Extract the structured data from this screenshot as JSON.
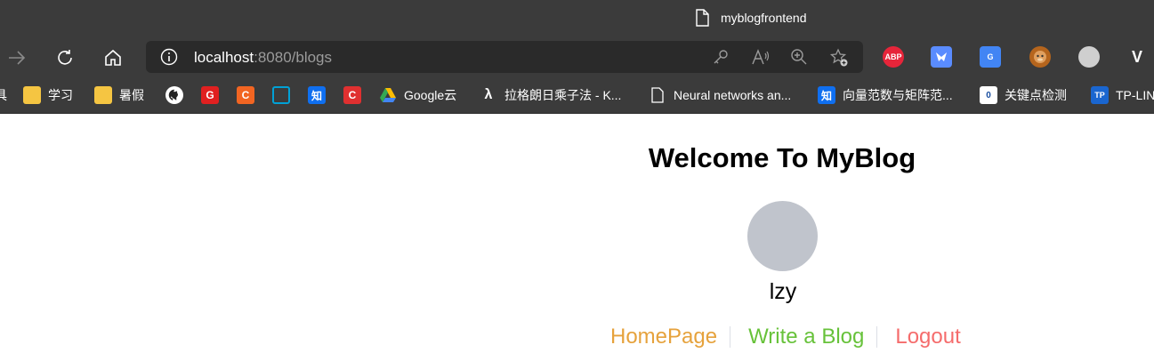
{
  "window": {
    "title": "myblogfrontend"
  },
  "address_bar": {
    "host": "localhost",
    "path": ":8080/blogs"
  },
  "bookmarks": [
    {
      "label": "具",
      "icon": "folder-icon"
    },
    {
      "label": "学习",
      "icon": "folder-icon"
    },
    {
      "label": "暑假",
      "icon": "folder-icon"
    },
    {
      "label": "",
      "icon": "github-icon"
    },
    {
      "label": "",
      "icon": "g-red-icon"
    },
    {
      "label": "",
      "icon": "c-orange-icon"
    },
    {
      "label": "",
      "icon": "bilibili-icon"
    },
    {
      "label": "",
      "icon": "zhihu-icon"
    },
    {
      "label": "",
      "icon": "c-red-icon"
    },
    {
      "label": "Google云",
      "icon": "google-drive-icon"
    },
    {
      "label": "拉格朗日乘子法 - K...",
      "icon": "lambda-icon"
    },
    {
      "label": "Neural networks an...",
      "icon": "page-icon"
    },
    {
      "label": "向量范数与矩阵范...",
      "icon": "zhihu-icon"
    },
    {
      "label": "关键点检测",
      "icon": "keypoint-icon"
    },
    {
      "label": "TP-LIN",
      "icon": "tplink-icon"
    }
  ],
  "extensions": [
    {
      "name": "adblock-plus-icon",
      "text": "ABP",
      "color": "#e6253a"
    },
    {
      "name": "bird-extension-icon",
      "text": "",
      "color": "#5a8cff"
    },
    {
      "name": "google-translate-icon",
      "text": "G",
      "color": "#4285f4"
    },
    {
      "name": "monkey-extension-icon",
      "text": "",
      "color": "#b5651d"
    },
    {
      "name": "shell-extension-icon",
      "text": "",
      "color": "#cfcfcf"
    },
    {
      "name": "vue-devtools-icon",
      "text": "V",
      "color": "#41b883"
    }
  ],
  "page": {
    "title": "Welcome To MyBlog",
    "username": "lzy",
    "nav": {
      "home": "HomePage",
      "write": "Write a Blog",
      "logout": "Logout"
    }
  },
  "colors": {
    "home_link": "#e6a23c",
    "write_link": "#67c23a",
    "logout_link": "#f56c6c",
    "avatar_bg": "#c0c4cc",
    "chrome_bg": "#3b3b3b"
  }
}
